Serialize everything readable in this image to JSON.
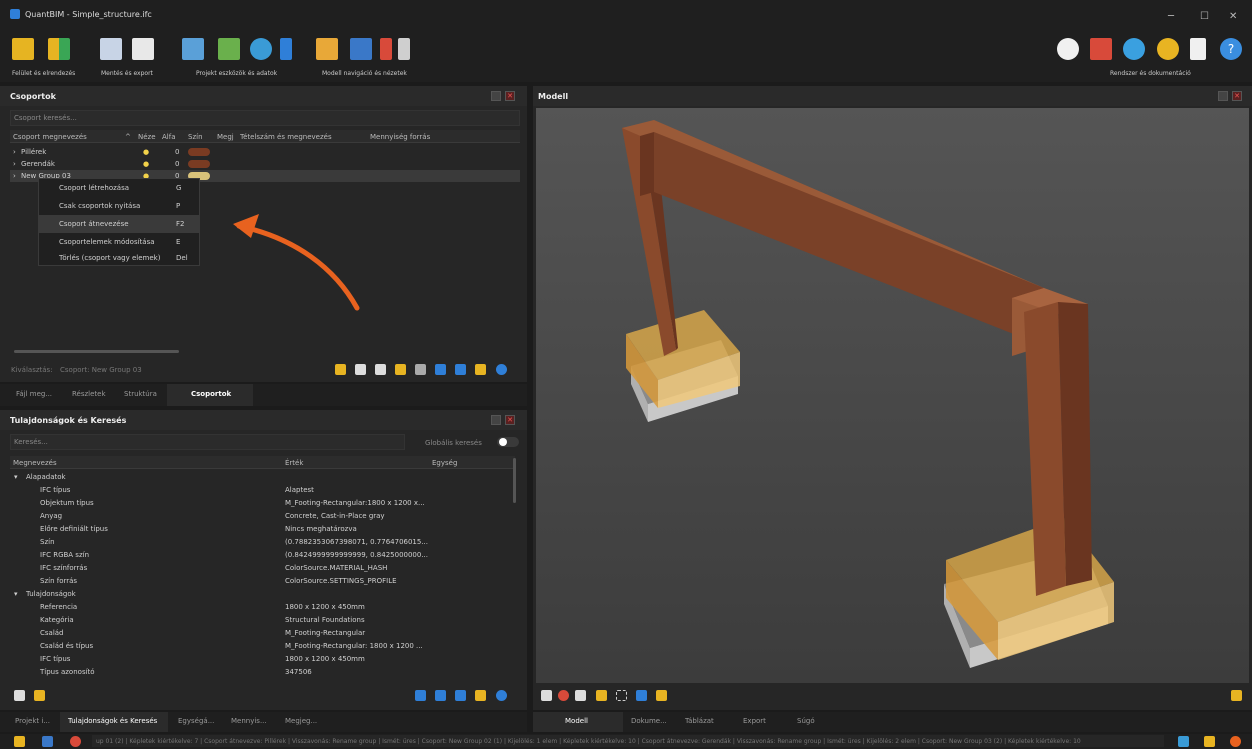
{
  "window": {
    "title": "QuantBIM - Simple_structure.ifc"
  },
  "ribbon": {
    "groups": [
      {
        "label": "Felület és elrendezés"
      },
      {
        "label": "Mentés és export"
      },
      {
        "label": "Projekt eszközök és adatok"
      },
      {
        "label": "Modell navigáció és nézetek"
      },
      {
        "label": "Rendszer és dokumentáció"
      }
    ]
  },
  "groups_panel": {
    "title": "Csoportok",
    "search_placeholder": "Csoport keresés...",
    "columns": [
      "Csoport megnevezés",
      "Néze",
      "Alfa",
      "Szín",
      "Megj",
      "Tételszám és megnevezés",
      "Mennyiség forrás"
    ],
    "rows": [
      {
        "name": "Pillérek",
        "alpha": "0",
        "color": "#7a3b22"
      },
      {
        "name": "Gerendák",
        "alpha": "0",
        "color": "#7a3b22"
      },
      {
        "name": "New Group 03",
        "alpha": "0",
        "color": "#d9c27a"
      }
    ],
    "context_menu": [
      {
        "label": "Csoport létrehozása",
        "shortcut": "G"
      },
      {
        "label": "Csak csoportok nyitása",
        "shortcut": "P"
      },
      {
        "label": "Csoport átnevezése",
        "shortcut": "F2"
      },
      {
        "label": "Csoportelemek módosítása",
        "shortcut": "E"
      },
      {
        "label": "Törlés (csoport vagy elemek)",
        "shortcut": "Del"
      }
    ],
    "selection_label": "Kiválasztás:",
    "selection_value": "Csoport: New Group 03"
  },
  "left_tabs": [
    "Fájl meg...",
    "Részletek",
    "Struktúra",
    "Csoportok"
  ],
  "props_panel": {
    "title": "Tulajdonságok és Keresés",
    "search_placeholder": "Keresés...",
    "global_label": "Globális keresés",
    "columns": [
      "Megnevezés",
      "Érték",
      "Egység"
    ],
    "sections": [
      {
        "name": "Alapadatok",
        "rows": [
          {
            "k": "IFC típus",
            "v": "Alaptest"
          },
          {
            "k": "Objektum típus",
            "v": "M_Footing-Rectangular:1800 x 1200 x..."
          },
          {
            "k": "Anyag",
            "v": "Concrete, Cast-in-Place gray"
          },
          {
            "k": "Előre definiált típus",
            "v": "Nincs meghatározva"
          },
          {
            "k": "Szín",
            "v": "(0.7882353067398071, 0.7764706015..."
          },
          {
            "k": "IFC RGBA szín",
            "v": "(0.8424999999999999, 0.8425000000..."
          },
          {
            "k": "IFC színforrás",
            "v": "ColorSource.MATERIAL_HASH"
          },
          {
            "k": "Szín forrás",
            "v": "ColorSource.SETTINGS_PROFILE"
          }
        ]
      },
      {
        "name": "Tulajdonságok",
        "rows": [
          {
            "k": "Referencia",
            "v": "1800 x 1200 x 450mm"
          },
          {
            "k": "Kategória",
            "v": "Structural Foundations"
          },
          {
            "k": "Család",
            "v": "M_Footing-Rectangular"
          },
          {
            "k": "Család és típus",
            "v": "M_Footing-Rectangular: 1800 x 1200 ..."
          },
          {
            "k": "IFC típus",
            "v": "1800 x 1200 x 450mm"
          },
          {
            "k": "Típus azonosító",
            "v": "347506"
          }
        ]
      }
    ]
  },
  "bottom_left_tabs": [
    "Projekt i...",
    "Tulajdonságok és Keresés",
    "Egységá...",
    "Mennyis...",
    "Megjeg..."
  ],
  "model_panel": {
    "title": "Modell"
  },
  "model_tabs": [
    "Modell",
    "Dokume...",
    "Táblázat",
    "Export",
    "Súgó"
  ],
  "statusbar": {
    "text": "up 01 (2) | Képletek kiértékelve: 7 | Csoport átnevezve: Pillérek | Visszavonás: Rename group | Ismét: üres | Csoport: New Group 02 (1) | Kijelölés: 1 elem | Képletek kiértékelve: 10 | Csoport átnevezve: Gerendák | Visszavonás: Rename group | Ismét: üres | Kijelölés: 2 elem | Csoport: New Group 03 (2) | Képletek kiértékelve: 10"
  },
  "colors": {
    "accent": "#2f7fd8",
    "arrow": "#e8621f",
    "timber": "#7a4128",
    "footing": "#e8b24a"
  }
}
